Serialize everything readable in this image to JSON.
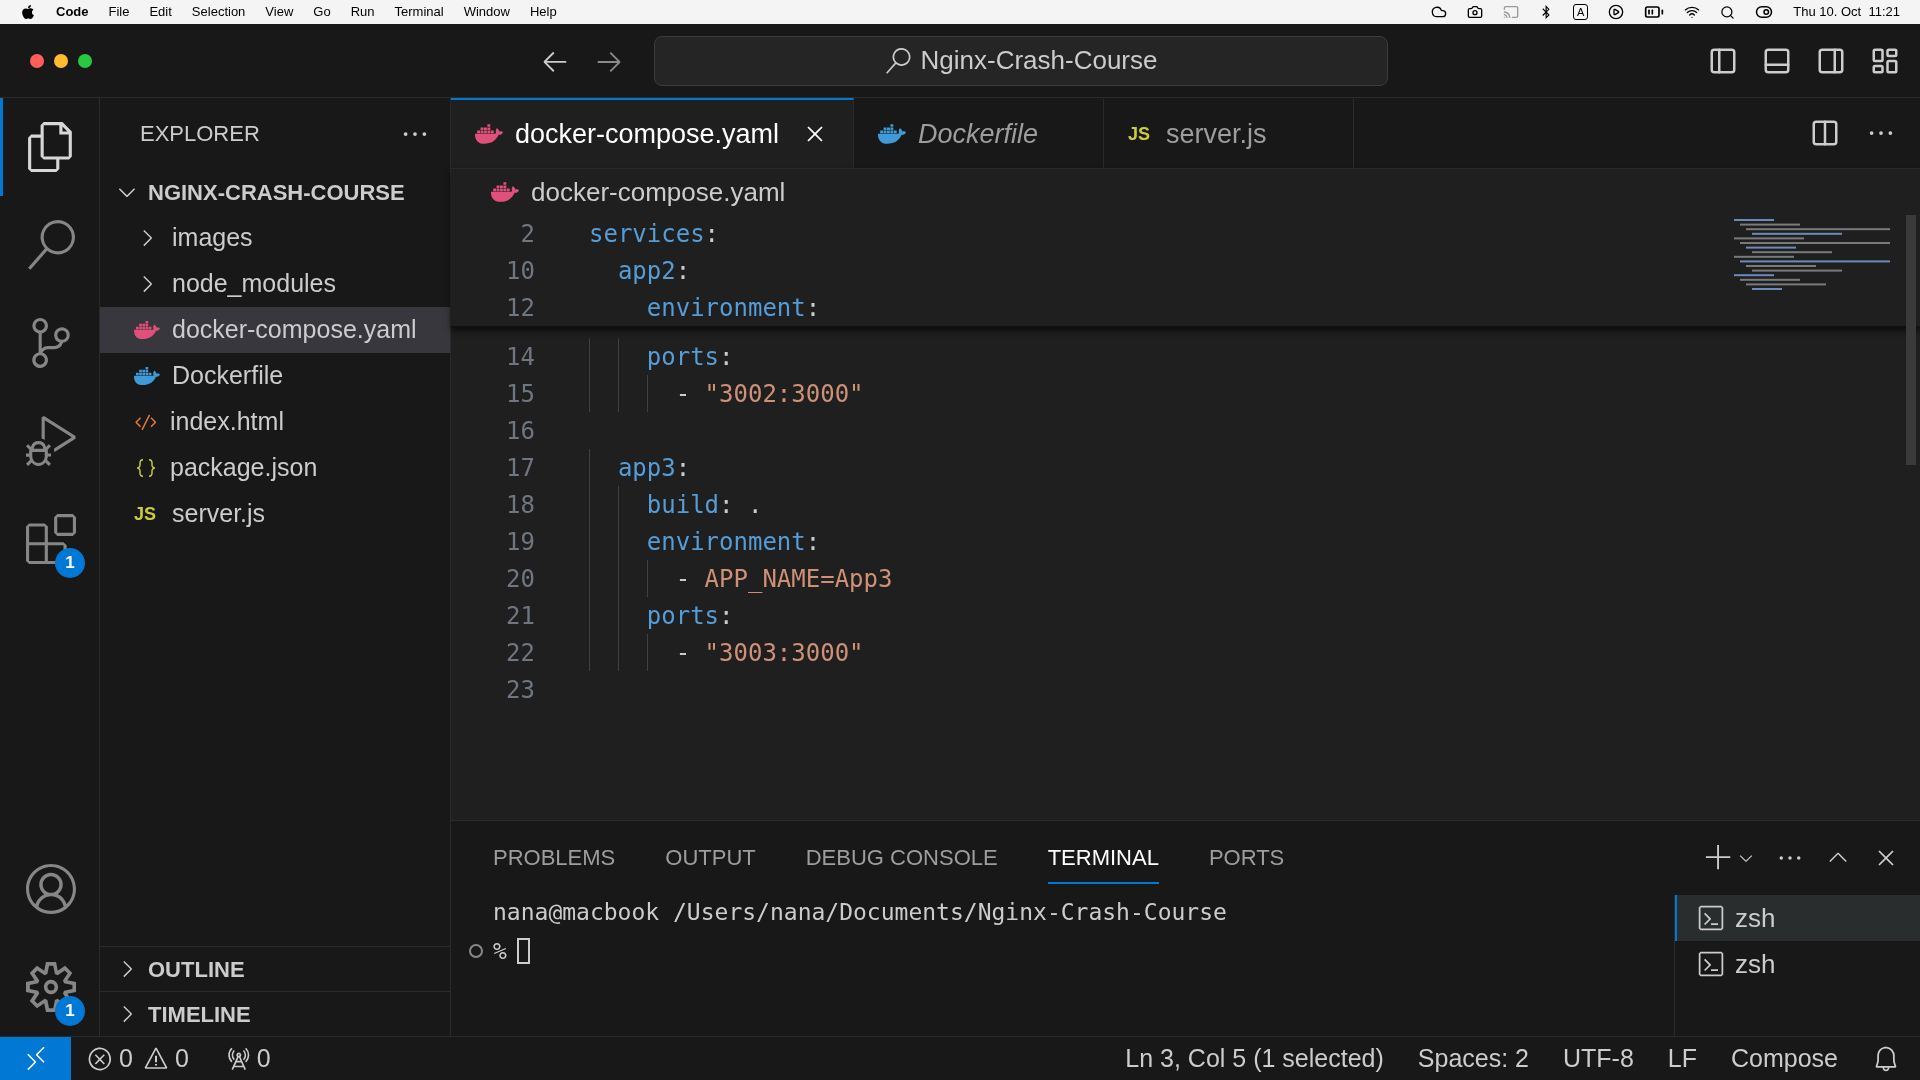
{
  "menu_bar": {
    "app": "Code",
    "menus": [
      "File",
      "Edit",
      "Selection",
      "View",
      "Go",
      "Run",
      "Terminal",
      "Window",
      "Help"
    ],
    "input_source": "A",
    "clock": "Thu 10. Oct  11:21"
  },
  "title_bar": {
    "search": "Nginx-Crash-Course"
  },
  "activity_bar": [
    {
      "kind": "explorer",
      "selected": true
    },
    {
      "kind": "search",
      "selected": false
    },
    {
      "kind": "source-control",
      "selected": false
    },
    {
      "kind": "run-debug",
      "selected": false
    },
    {
      "kind": "extensions",
      "selected": false,
      "badge": "1"
    }
  ],
  "activity_bar_bottom": [
    {
      "kind": "account"
    },
    {
      "kind": "settings",
      "badge": "1"
    }
  ],
  "sidebar": {
    "title": "EXPLORER",
    "root": {
      "label": "NGINX-CRASH-COURSE",
      "expanded": true,
      "children": [
        {
          "label": "images",
          "kind": "folder",
          "expanded": false,
          "selected": false
        },
        {
          "label": "node_modules",
          "kind": "folder",
          "expanded": false,
          "selected": false
        },
        {
          "label": "docker-compose.yaml",
          "kind": "compose",
          "selected": true
        },
        {
          "label": "Dockerfile",
          "kind": "docker",
          "selected": false
        },
        {
          "label": "index.html",
          "kind": "html",
          "selected": false
        },
        {
          "label": "package.json",
          "kind": "json",
          "selected": false
        },
        {
          "label": "server.js",
          "kind": "js",
          "icon_text": "JS",
          "selected": false
        }
      ]
    },
    "sections": [
      {
        "label": "OUTLINE",
        "expanded": false
      },
      {
        "label": "TIMELINE",
        "expanded": false
      }
    ]
  },
  "tabs": [
    {
      "label": "docker-compose.yaml",
      "kind": "compose",
      "selected": true,
      "preview": false
    },
    {
      "label": "Dockerfile",
      "kind": "docker",
      "selected": false,
      "preview": true
    },
    {
      "label": "server.js",
      "kind": "js",
      "icon_text": "JS",
      "selected": false,
      "preview": false
    }
  ],
  "breadcrumb": {
    "label": "docker-compose.yaml",
    "kind": "compose"
  },
  "sticky_lines": [
    {
      "number": "2",
      "text": "services:"
    },
    {
      "number": "10",
      "text": "  app2:"
    },
    {
      "number": "12",
      "text": "    environment:"
    }
  ],
  "lines": [
    {
      "number": "14",
      "text": "    ports:"
    },
    {
      "number": "15",
      "text": "      - \"3002:3000\""
    },
    {
      "number": "16"
    },
    {
      "number": "17",
      "text": "  app3:"
    },
    {
      "number": "18",
      "text": "    build: ."
    },
    {
      "number": "19",
      "text": "    environment:"
    },
    {
      "number": "20",
      "text": "      - APP_NAME=App3"
    },
    {
      "number": "21",
      "text": "    ports:"
    },
    {
      "number": "22",
      "text": "      - \"3003:3000\""
    },
    {
      "number": "23"
    }
  ],
  "panel": {
    "tabs": [
      {
        "label": "PROBLEMS",
        "selected": false
      },
      {
        "label": "OUTPUT",
        "selected": false
      },
      {
        "label": "DEBUG CONSOLE",
        "selected": false
      },
      {
        "label": "TERMINAL",
        "selected": true
      },
      {
        "label": "PORTS",
        "selected": false
      }
    ],
    "terminal": {
      "lines": [
        "nana@macbook /Users/nana/Documents/Nginx-Crash-Course"
      ],
      "prompt": "%"
    },
    "terminals": [
      {
        "label": "zsh",
        "selected": true
      },
      {
        "label": "zsh",
        "selected": false
      }
    ]
  },
  "status_bar": {
    "errors": "0",
    "warnings": "0",
    "ports": "0",
    "right": [
      "Ln 3, Col 5 (1 selected)",
      "Spaces: 2",
      "UTF-8",
      "LF",
      "Compose"
    ]
  }
}
